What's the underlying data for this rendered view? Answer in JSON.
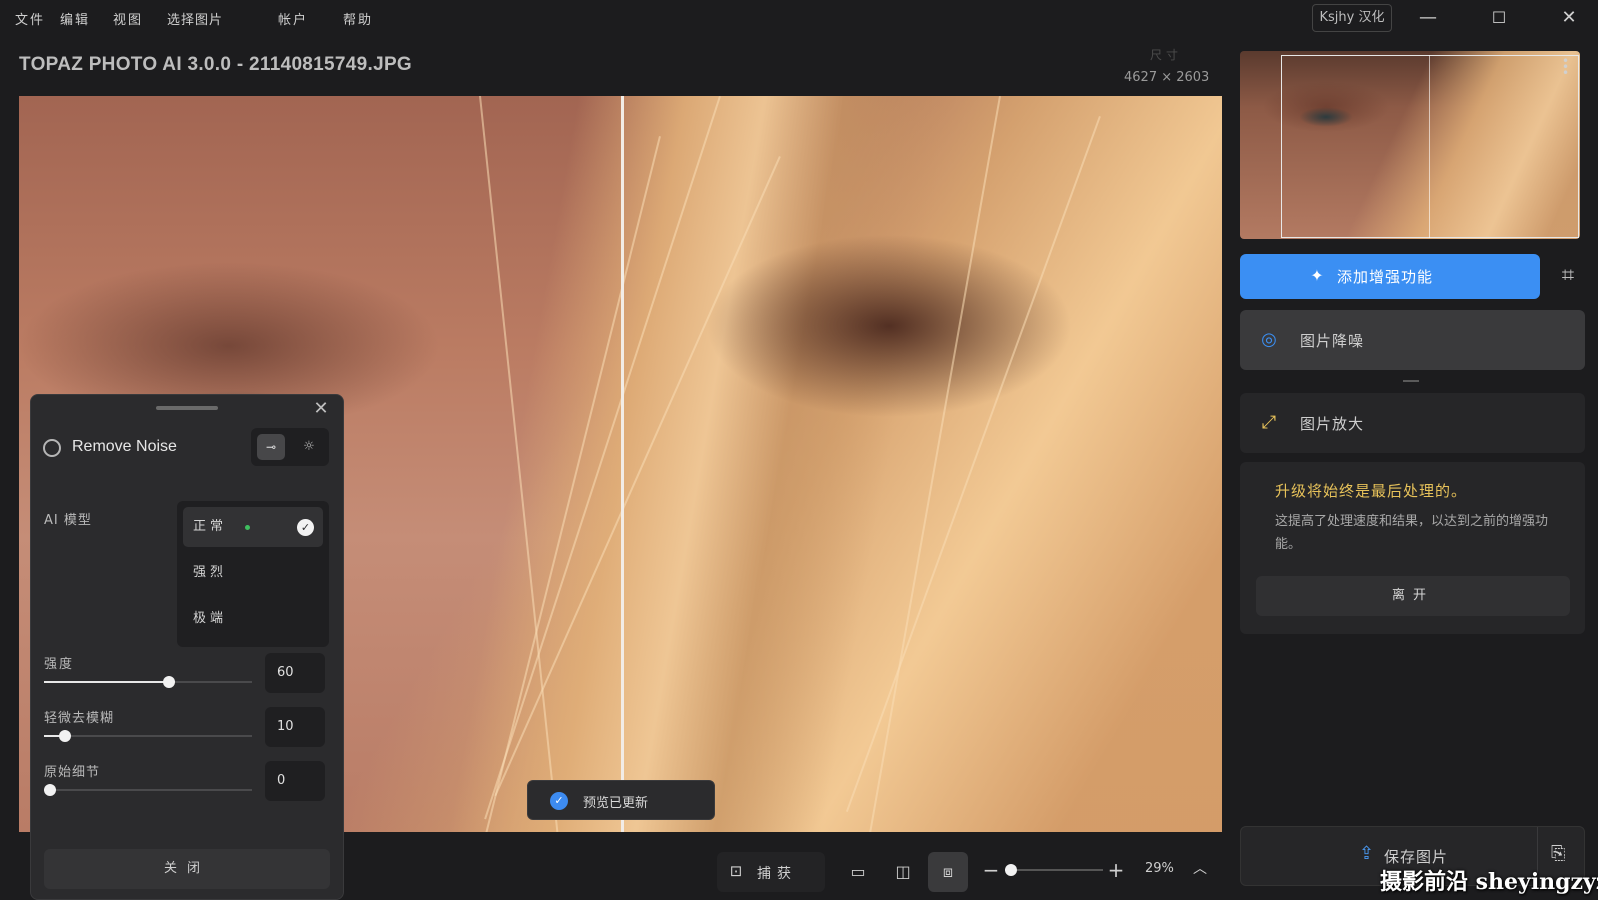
{
  "menu": [
    "文件",
    "编辑",
    "视图",
    "选择图片",
    "帐户",
    "帮助"
  ],
  "window": {
    "badge": "Ksjhy 汉化",
    "minimize_icon": "minimize-icon",
    "maximize_icon": "maximize-icon",
    "close_icon": "close-icon"
  },
  "title": "TOPAZ PHOTO AI 3.0.0 - 21140815749.JPG",
  "dimensions": {
    "label": "尺寸",
    "value": "4627 × 2603"
  },
  "panel": {
    "title": "Remove Noise",
    "ai_model_label": "AI 模型",
    "models": [
      {
        "label": "正常",
        "selected": true
      },
      {
        "label": "强烈",
        "selected": false
      },
      {
        "label": "极端",
        "selected": false
      }
    ],
    "sliders": [
      {
        "label": "强度",
        "value": "60",
        "fraction": 0.6
      },
      {
        "label": "轻微去模糊",
        "value": "10",
        "fraction": 0.1
      },
      {
        "label": "原始细节",
        "value": "0",
        "fraction": 0.0
      }
    ],
    "close_label": "关闭"
  },
  "toast": {
    "text": "预览已更新"
  },
  "toolbar": {
    "capture_label": "捕获",
    "zoom_value": "29%",
    "zoom_fraction": 0.29
  },
  "sidebar": {
    "add_enhancement": "添加增强功能",
    "enhancements": [
      {
        "label": "图片降噪",
        "icon": "denoise-icon",
        "selected": true
      },
      {
        "label": "图片放大",
        "icon": "upscale-icon",
        "selected": false
      }
    ],
    "notice": {
      "title": "升级将始终是最后处理的。",
      "body": "这提高了处理速度和结果，以达到之前的增强功能。",
      "leave_label": "离开"
    },
    "save_label": "保存图片"
  },
  "watermark": "摄影前沿 sheyingzyz.com",
  "colors": {
    "accent": "#3b8ff3",
    "notice_title": "#e7c25a",
    "status_green": "#3fbf5f"
  }
}
